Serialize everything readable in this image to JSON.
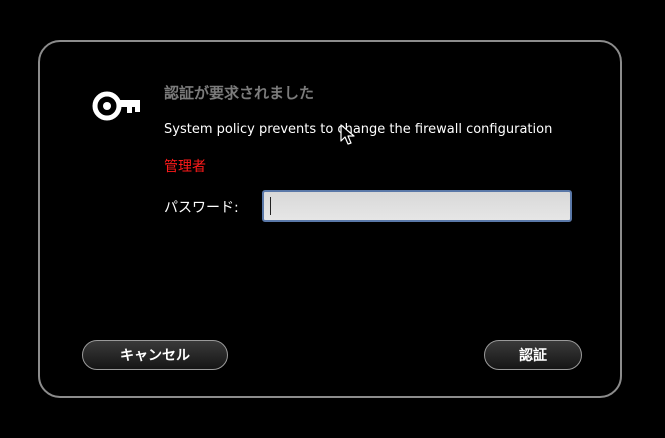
{
  "dialog": {
    "title": "認証が要求されました",
    "message": "System policy prevents to change the firewall configuration",
    "user": "管理者",
    "password_label": "パスワード:",
    "password_value": "",
    "cancel_label": "キャンセル",
    "authenticate_label": "認証"
  },
  "icons": {
    "dialog_icon": "key-icon",
    "pointer": "mouse-pointer-icon"
  },
  "colors": {
    "background": "#000000",
    "title": "#7b7b7b",
    "user": "#ff1a1a",
    "input_border": "#5a78a8"
  }
}
